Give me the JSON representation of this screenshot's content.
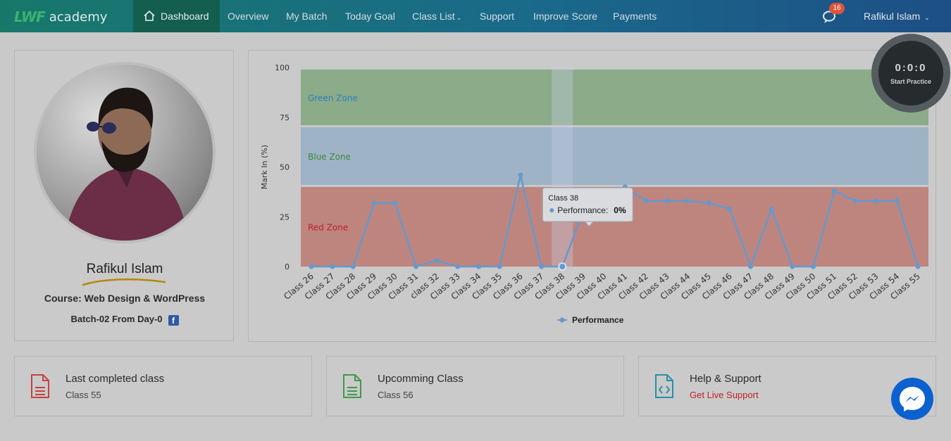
{
  "brand": {
    "mark": "LWF",
    "name": "academy"
  },
  "nav": {
    "items": [
      {
        "label": "Dashboard"
      },
      {
        "label": "Overview"
      },
      {
        "label": "My Batch"
      },
      {
        "label": "Today Goal"
      },
      {
        "label": "Class List"
      },
      {
        "label": "Support"
      },
      {
        "label": "Improve Score"
      },
      {
        "label": "Payments"
      }
    ],
    "notifications": "16",
    "user": "Rafikul Islam"
  },
  "profile": {
    "name": "Rafikul Islam",
    "course": "Course: Web Design & WordPress",
    "batch": "Batch-02 From Day-0"
  },
  "timer": {
    "time": "0:0:0",
    "label": "Start Practice"
  },
  "cards": [
    {
      "title": "Last completed class",
      "subtitle": "Class 55"
    },
    {
      "title": "Upcomming Class",
      "subtitle": "Class 56"
    },
    {
      "title": "Help & Support",
      "subtitle": "Get Live Support"
    }
  ],
  "colors": {
    "accent_red": "#c0202a",
    "nav_start": "#17786a",
    "nav_end": "#1d4f86"
  },
  "chart_data": {
    "type": "line",
    "ylabel": "Mark In (%)",
    "ylim": [
      0,
      100
    ],
    "yticks": [
      "100",
      "75",
      "50",
      "25",
      "0"
    ],
    "zones": [
      {
        "name": "Green Zone",
        "from": 71,
        "to": 99,
        "color": "#8bab89",
        "label_color": "#2a7fbd"
      },
      {
        "name": "Blue Zone",
        "from": 41,
        "to": 70,
        "color": "#9fb3c6",
        "label_color": "#3a8a3a"
      },
      {
        "name": "Red Zone",
        "from": 0,
        "to": 40,
        "color": "#be857f",
        "label_color": "#c0202a"
      }
    ],
    "categories": [
      "Class 26",
      "Class 27",
      "Class 28",
      "Class 29",
      "Class 30",
      "Class 31",
      "class 32",
      "Class 33",
      "Class 34",
      "Class 35",
      "Class 36",
      "Class 37",
      "Class 38",
      "Class 39",
      "Class 40",
      "Class 41",
      "Class 42",
      "Class 43",
      "Class 44",
      "Class 45",
      "Class 46",
      "Class 47",
      "Class 48",
      "Class 49",
      "Class 50",
      "Class 51",
      "Class 52",
      "Class 53",
      "Class 54",
      "Class 55"
    ],
    "series": [
      {
        "name": "Performance",
        "values": [
          0,
          0,
          0,
          32,
          32,
          0,
          3,
          0,
          0,
          0,
          46,
          0,
          0,
          28,
          33,
          40,
          33,
          33,
          33,
          32,
          29,
          0,
          29,
          0,
          0,
          38,
          33,
          33,
          33,
          0
        ],
        "color": "#6699cc"
      }
    ],
    "tooltip": {
      "category": "Class 38",
      "label": "Performance:",
      "value": "0%"
    },
    "legend": "bottom-center"
  }
}
